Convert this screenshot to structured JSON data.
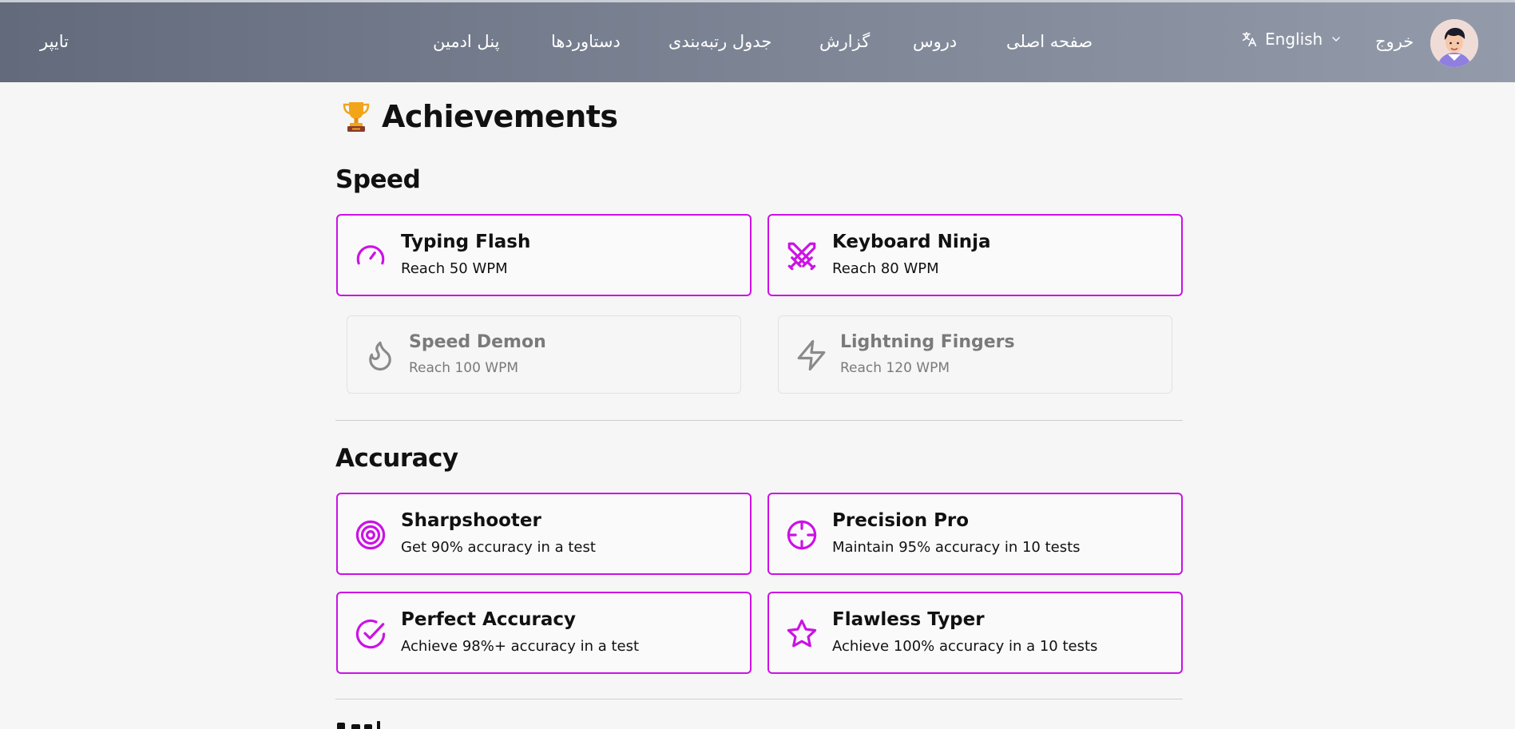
{
  "nav": {
    "brand": "تایپر",
    "links": [
      "صفحه اصلی",
      "دروس",
      "گزارش",
      "جدول رتبه‌بندی",
      "دستاوردها",
      "پنل ادمین"
    ],
    "language": "English",
    "logout": "خروج"
  },
  "page": {
    "title": "Achievements"
  },
  "accent_color": "#cc11e6",
  "sections": [
    {
      "title": "Speed",
      "achievements": [
        {
          "title": "Typing Flash",
          "description": "Reach 50 WPM",
          "icon": "speedometer-icon",
          "unlocked": true
        },
        {
          "title": "Keyboard Ninja",
          "description": "Reach 80 WPM",
          "icon": "crossed-swords-icon",
          "unlocked": true
        },
        {
          "title": "Speed Demon",
          "description": "Reach 100 WPM",
          "icon": "flame-icon",
          "unlocked": false
        },
        {
          "title": "Lightning Fingers",
          "description": "Reach 120 WPM",
          "icon": "lightning-icon",
          "unlocked": false
        }
      ]
    },
    {
      "title": "Accuracy",
      "achievements": [
        {
          "title": "Sharpshooter",
          "description": "Get 90% accuracy in a test",
          "icon": "target-icon",
          "unlocked": true
        },
        {
          "title": "Precision Pro",
          "description": "Maintain 95% accuracy in 10 tests",
          "icon": "crosshair-icon",
          "unlocked": true
        },
        {
          "title": "Perfect Accuracy",
          "description": "Achieve 98%+ accuracy in a test",
          "icon": "check-circle-icon",
          "unlocked": true
        },
        {
          "title": "Flawless Typer",
          "description": "Achieve 100% accuracy in a 10 tests",
          "icon": "star-icon",
          "unlocked": true
        }
      ]
    }
  ]
}
